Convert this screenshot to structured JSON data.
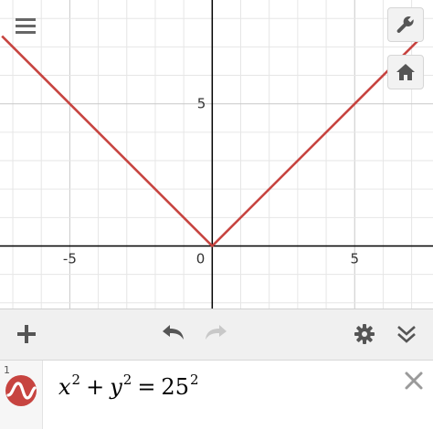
{
  "graph": {
    "x_tick_labels": [
      "-5",
      "0",
      "5"
    ],
    "y_tick_labels": [
      "5"
    ],
    "curve_color": "#c74440",
    "curve_points": [
      [
        -7.38,
        7.38
      ],
      [
        0,
        0
      ],
      [
        7.38,
        7.38
      ]
    ],
    "x_range": [
      -7.45,
      7.75
    ],
    "y_range": [
      -2.2,
      8.65
    ]
  },
  "top_left_button": {
    "icon": "hamburger-menu-icon"
  },
  "top_right_buttons": [
    {
      "name": "settings-wrench",
      "icon": "wrench-icon"
    },
    {
      "name": "default-zoom",
      "icon": "home-icon"
    }
  ],
  "toolbar": {
    "add_icon": "plus-icon",
    "undo_icon": "undo-icon",
    "redo_icon": "redo-icon",
    "settings_icon": "gear-icon",
    "collapse_icon": "double-chevron-down-icon"
  },
  "expressions": [
    {
      "index": "1",
      "x_var": "x",
      "x_exp": "2",
      "plus": "+",
      "y_var": "y",
      "y_exp": "2",
      "equals": "=",
      "rhs_base": "25",
      "rhs_exp": "2",
      "color": "#c74440"
    }
  ]
}
